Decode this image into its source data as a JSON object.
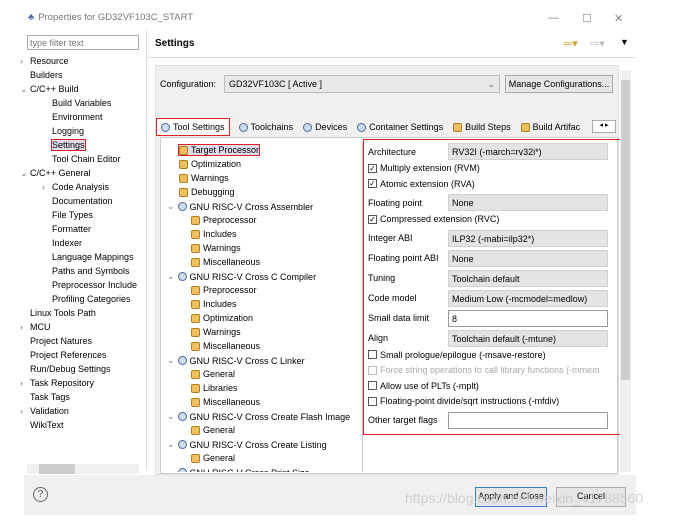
{
  "window": {
    "title": "Properties for GD32VF103C_START",
    "minimize": "—",
    "maximize": "☐",
    "close": "✕"
  },
  "filter": {
    "placeholder": "type filter text"
  },
  "left_tree": [
    {
      "label": "Resource",
      "indent": 1,
      "arrow": "›"
    },
    {
      "label": "Builders",
      "indent": 1
    },
    {
      "label": "C/C++ Build",
      "indent": 1,
      "arrow": "⌄"
    },
    {
      "label": "Build Variables",
      "indent": 2
    },
    {
      "label": "Environment",
      "indent": 2
    },
    {
      "label": "Logging",
      "indent": 2
    },
    {
      "label": "Settings",
      "indent": 2,
      "selected": true
    },
    {
      "label": "Tool Chain Editor",
      "indent": 2
    },
    {
      "label": "C/C++ General",
      "indent": 1,
      "arrow": "⌄"
    },
    {
      "label": "Code Analysis",
      "indent": 2,
      "arrow": "›"
    },
    {
      "label": "Documentation",
      "indent": 2
    },
    {
      "label": "File Types",
      "indent": 2
    },
    {
      "label": "Formatter",
      "indent": 2
    },
    {
      "label": "Indexer",
      "indent": 2
    },
    {
      "label": "Language Mappings",
      "indent": 2
    },
    {
      "label": "Paths and Symbols",
      "indent": 2
    },
    {
      "label": "Preprocessor Include",
      "indent": 2
    },
    {
      "label": "Profiling Categories",
      "indent": 2
    },
    {
      "label": "Linux Tools Path",
      "indent": 1
    },
    {
      "label": "MCU",
      "indent": 1,
      "arrow": "›"
    },
    {
      "label": "Project Natures",
      "indent": 1
    },
    {
      "label": "Project References",
      "indent": 1
    },
    {
      "label": "Run/Debug Settings",
      "indent": 1
    },
    {
      "label": "Task Repository",
      "indent": 1,
      "arrow": "›"
    },
    {
      "label": "Task Tags",
      "indent": 1
    },
    {
      "label": "Validation",
      "indent": 1,
      "arrow": "›"
    },
    {
      "label": "WikiText",
      "indent": 1
    }
  ],
  "header": {
    "title": "Settings"
  },
  "configuration": {
    "label": "Configuration:",
    "value": "GD32VF103C  [ Active ]",
    "manage": "Manage Configurations..."
  },
  "tabs": [
    "Tool Settings",
    "Toolchains",
    "Devices",
    "Container Settings",
    "Build Steps",
    "Build Artifac"
  ],
  "tool_tree": [
    {
      "label": "Target Processor",
      "indent": 1,
      "selected": true
    },
    {
      "label": "Optimization",
      "indent": 1
    },
    {
      "label": "Warnings",
      "indent": 1
    },
    {
      "label": "Debugging",
      "indent": 1
    },
    {
      "label": "GNU RISC-V Cross Assembler",
      "indent": 0,
      "tool": true
    },
    {
      "label": "Preprocessor",
      "indent": 2
    },
    {
      "label": "Includes",
      "indent": 2
    },
    {
      "label": "Warnings",
      "indent": 2
    },
    {
      "label": "Miscellaneous",
      "indent": 2
    },
    {
      "label": "GNU RISC-V Cross C Compiler",
      "indent": 0,
      "tool": true
    },
    {
      "label": "Preprocessor",
      "indent": 2
    },
    {
      "label": "Includes",
      "indent": 2
    },
    {
      "label": "Optimization",
      "indent": 2
    },
    {
      "label": "Warnings",
      "indent": 2
    },
    {
      "label": "Miscellaneous",
      "indent": 2
    },
    {
      "label": "GNU RISC-V Cross C Linker",
      "indent": 0,
      "tool": true
    },
    {
      "label": "General",
      "indent": 2
    },
    {
      "label": "Libraries",
      "indent": 2
    },
    {
      "label": "Miscellaneous",
      "indent": 2
    },
    {
      "label": "GNU RISC-V Cross Create Flash Image",
      "indent": 0,
      "tool": true
    },
    {
      "label": "General",
      "indent": 2
    },
    {
      "label": "GNU RISC-V Cross Create Listing",
      "indent": 0,
      "tool": true
    },
    {
      "label": "General",
      "indent": 2
    },
    {
      "label": "GNU RISC-V Cross Print Size",
      "indent": 0,
      "tool": true
    }
  ],
  "settings": [
    {
      "type": "field",
      "label": "Architecture",
      "value": "RV32I (-march=rv32i*)"
    },
    {
      "type": "check",
      "label": "Multiply extension (RVM)",
      "checked": true
    },
    {
      "type": "check",
      "label": "Atomic extension (RVA)",
      "checked": true
    },
    {
      "type": "field",
      "label": "Floating point",
      "value": "None"
    },
    {
      "type": "check",
      "label": "Compressed extension (RVC)",
      "checked": true
    },
    {
      "type": "field",
      "label": "Integer ABI",
      "value": "ILP32 (-mabi=ilp32*)"
    },
    {
      "type": "field",
      "label": "Floating point ABI",
      "value": "None"
    },
    {
      "type": "field",
      "label": "Tuning",
      "value": "Toolchain default"
    },
    {
      "type": "field",
      "label": "Code model",
      "value": "Medium Low (-mcmodel=medlow)"
    },
    {
      "type": "input",
      "label": "Small data limit",
      "value": "8"
    },
    {
      "type": "field",
      "label": "Align",
      "value": "Toolchain default (-mtune)"
    },
    {
      "type": "check",
      "label": "Small prologue/epilogue (-msave-restore)",
      "checked": false
    },
    {
      "type": "check",
      "label": "Force string operations to call library functions (-mmem",
      "checked": false,
      "disabled": true
    },
    {
      "type": "check",
      "label": "Allow use of PLTs (-mplt)",
      "checked": false
    },
    {
      "type": "check",
      "label": "Floating-point divide/sqrt instructions (-mfdiv)",
      "checked": false
    },
    {
      "type": "input",
      "label": "Other target flags",
      "value": ""
    }
  ],
  "footer": {
    "help": "?",
    "apply": "Apply and Close",
    "cancel": "Cancel"
  },
  "watermark": "https://blog.csdn.net/weixin_41788560"
}
